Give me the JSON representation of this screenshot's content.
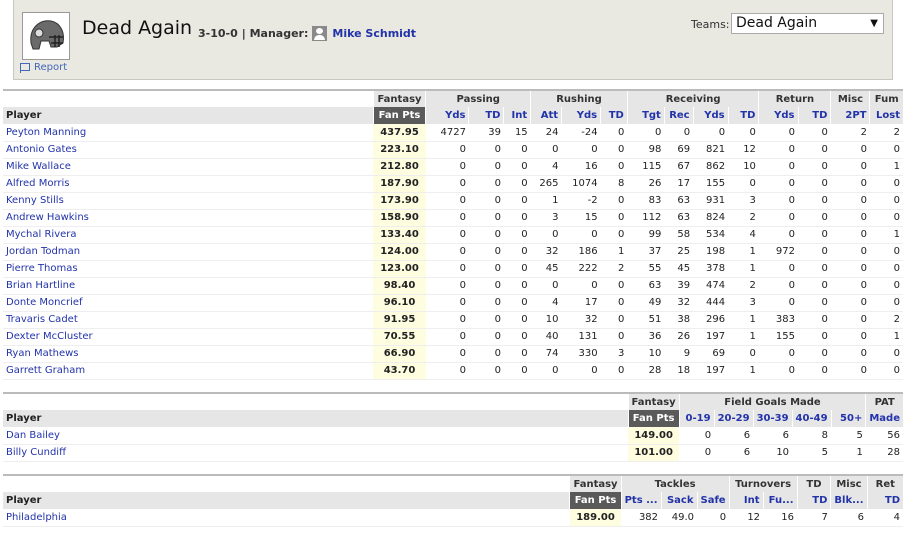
{
  "team": {
    "name": "Dead Again",
    "record": "3-10-0",
    "manager_label": "| Manager:",
    "manager_name": "Mike Schmidt",
    "report_label": "Report",
    "teams_label": "Teams:",
    "teams_selected": "Dead Again"
  },
  "offense": {
    "groups": [
      "Fantasy",
      "Passing",
      "Rushing",
      "Receiving",
      "Return",
      "Misc",
      "Fum"
    ],
    "player_header": "Player",
    "columns": [
      "Fan Pts",
      "Yds",
      "TD",
      "Int",
      "Att",
      "Yds",
      "TD",
      "Tgt",
      "Rec",
      "Yds",
      "TD",
      "Yds",
      "TD",
      "2PT",
      "Lost"
    ],
    "rows": [
      {
        "name": "Peyton Manning",
        "fan": "437.95",
        "stats": [
          "4727",
          "39",
          "15",
          "24",
          "-24",
          "0",
          "0",
          "0",
          "0",
          "0",
          "0",
          "0",
          "2",
          "2"
        ]
      },
      {
        "name": "Antonio Gates",
        "fan": "223.10",
        "stats": [
          "0",
          "0",
          "0",
          "0",
          "0",
          "0",
          "98",
          "69",
          "821",
          "12",
          "0",
          "0",
          "0",
          "0"
        ]
      },
      {
        "name": "Mike Wallace",
        "fan": "212.80",
        "stats": [
          "0",
          "0",
          "0",
          "4",
          "16",
          "0",
          "115",
          "67",
          "862",
          "10",
          "0",
          "0",
          "0",
          "1"
        ]
      },
      {
        "name": "Alfred Morris",
        "fan": "187.90",
        "stats": [
          "0",
          "0",
          "0",
          "265",
          "1074",
          "8",
          "26",
          "17",
          "155",
          "0",
          "0",
          "0",
          "0",
          "0"
        ]
      },
      {
        "name": "Kenny Stills",
        "fan": "173.90",
        "stats": [
          "0",
          "0",
          "0",
          "1",
          "-2",
          "0",
          "83",
          "63",
          "931",
          "3",
          "0",
          "0",
          "0",
          "0"
        ]
      },
      {
        "name": "Andrew Hawkins",
        "fan": "158.90",
        "stats": [
          "0",
          "0",
          "0",
          "3",
          "15",
          "0",
          "112",
          "63",
          "824",
          "2",
          "0",
          "0",
          "0",
          "0"
        ]
      },
      {
        "name": "Mychal Rivera",
        "fan": "133.40",
        "stats": [
          "0",
          "0",
          "0",
          "0",
          "0",
          "0",
          "99",
          "58",
          "534",
          "4",
          "0",
          "0",
          "0",
          "1"
        ]
      },
      {
        "name": "Jordan Todman",
        "fan": "124.00",
        "stats": [
          "0",
          "0",
          "0",
          "32",
          "186",
          "1",
          "37",
          "25",
          "198",
          "1",
          "972",
          "0",
          "0",
          "0"
        ]
      },
      {
        "name": "Pierre Thomas",
        "fan": "123.00",
        "stats": [
          "0",
          "0",
          "0",
          "45",
          "222",
          "2",
          "55",
          "45",
          "378",
          "1",
          "0",
          "0",
          "0",
          "0"
        ]
      },
      {
        "name": "Brian Hartline",
        "fan": "98.40",
        "stats": [
          "0",
          "0",
          "0",
          "0",
          "0",
          "0",
          "63",
          "39",
          "474",
          "2",
          "0",
          "0",
          "0",
          "0"
        ]
      },
      {
        "name": "Donte Moncrief",
        "fan": "96.10",
        "stats": [
          "0",
          "0",
          "0",
          "4",
          "17",
          "0",
          "49",
          "32",
          "444",
          "3",
          "0",
          "0",
          "0",
          "0"
        ]
      },
      {
        "name": "Travaris Cadet",
        "fan": "91.95",
        "stats": [
          "0",
          "0",
          "0",
          "10",
          "32",
          "0",
          "51",
          "38",
          "296",
          "1",
          "383",
          "0",
          "0",
          "2"
        ]
      },
      {
        "name": "Dexter McCluster",
        "fan": "70.55",
        "stats": [
          "0",
          "0",
          "0",
          "40",
          "131",
          "0",
          "36",
          "26",
          "197",
          "1",
          "155",
          "0",
          "0",
          "1"
        ]
      },
      {
        "name": "Ryan Mathews",
        "fan": "66.90",
        "stats": [
          "0",
          "0",
          "0",
          "74",
          "330",
          "3",
          "10",
          "9",
          "69",
          "0",
          "0",
          "0",
          "0",
          "0"
        ]
      },
      {
        "name": "Garrett Graham",
        "fan": "43.70",
        "stats": [
          "0",
          "0",
          "0",
          "0",
          "0",
          "0",
          "28",
          "18",
          "197",
          "1",
          "0",
          "0",
          "0",
          "0"
        ]
      }
    ]
  },
  "kickers": {
    "groups": [
      "Fantasy",
      "Field Goals Made",
      "PAT"
    ],
    "player_header": "Player",
    "columns": [
      "Fan Pts",
      "0-19",
      "20-29",
      "30-39",
      "40-49",
      "50+",
      "Made"
    ],
    "rows": [
      {
        "name": "Dan Bailey",
        "fan": "149.00",
        "stats": [
          "0",
          "6",
          "6",
          "8",
          "5",
          "56"
        ]
      },
      {
        "name": "Billy Cundiff",
        "fan": "101.00",
        "stats": [
          "0",
          "6",
          "10",
          "5",
          "1",
          "28"
        ]
      }
    ]
  },
  "defense": {
    "groups": [
      "Fantasy",
      "Tackles",
      "Turnovers",
      "TD",
      "Misc",
      "Ret"
    ],
    "player_header": "Player",
    "columns": [
      "Fan Pts",
      "Pts ...",
      "Sack",
      "Safe",
      "Int",
      "Fu...",
      "TD",
      "Blk...",
      "TD"
    ],
    "rows": [
      {
        "name": "Philadelphia",
        "fan": "189.00",
        "stats": [
          "382",
          "49.0",
          "0",
          "12",
          "16",
          "7",
          "6",
          "4"
        ]
      }
    ]
  }
}
